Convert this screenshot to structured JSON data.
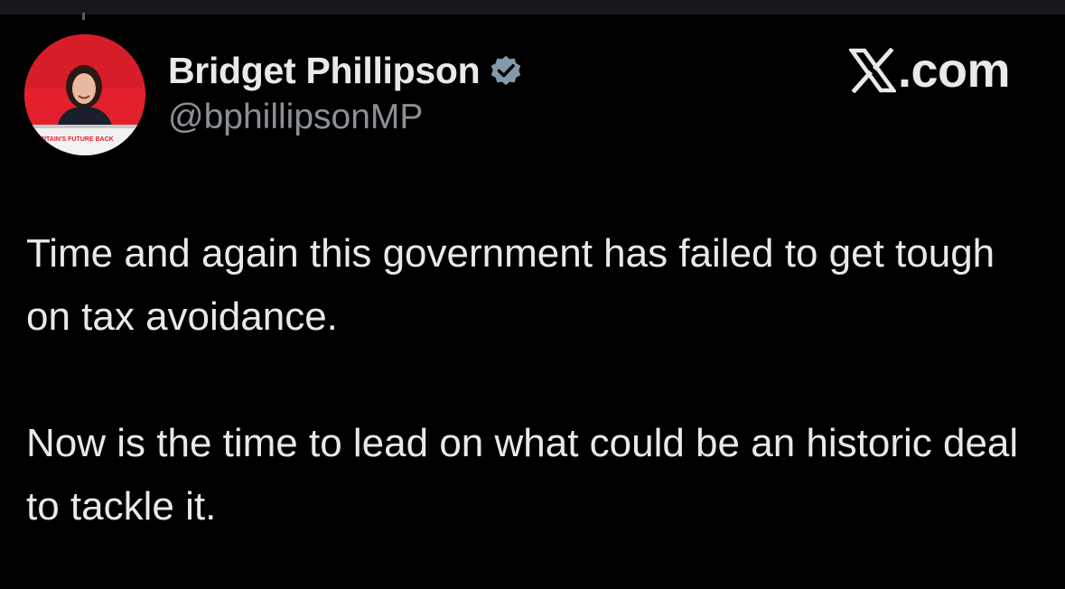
{
  "author": {
    "display_name": "Bridget Phillipson",
    "handle": "@bphillipsonMP",
    "verified": true,
    "avatar_icon": "profile-photo",
    "avatar_banner_text": "BRITAIN'S FUTURE BACK"
  },
  "brand": {
    "logo_icon": "x-logo-icon",
    "text": ".com"
  },
  "tweet": {
    "paragraphs": [
      "Time and again this government has failed to get tough on tax avoidance.",
      "Now is the time to lead on what could be an historic deal to tackle it."
    ]
  },
  "colors": {
    "background": "#000000",
    "text_primary": "#e7e9ea",
    "text_secondary": "#8b9096",
    "verified_badge": "#829aab",
    "avatar_background": "#e3202e"
  }
}
